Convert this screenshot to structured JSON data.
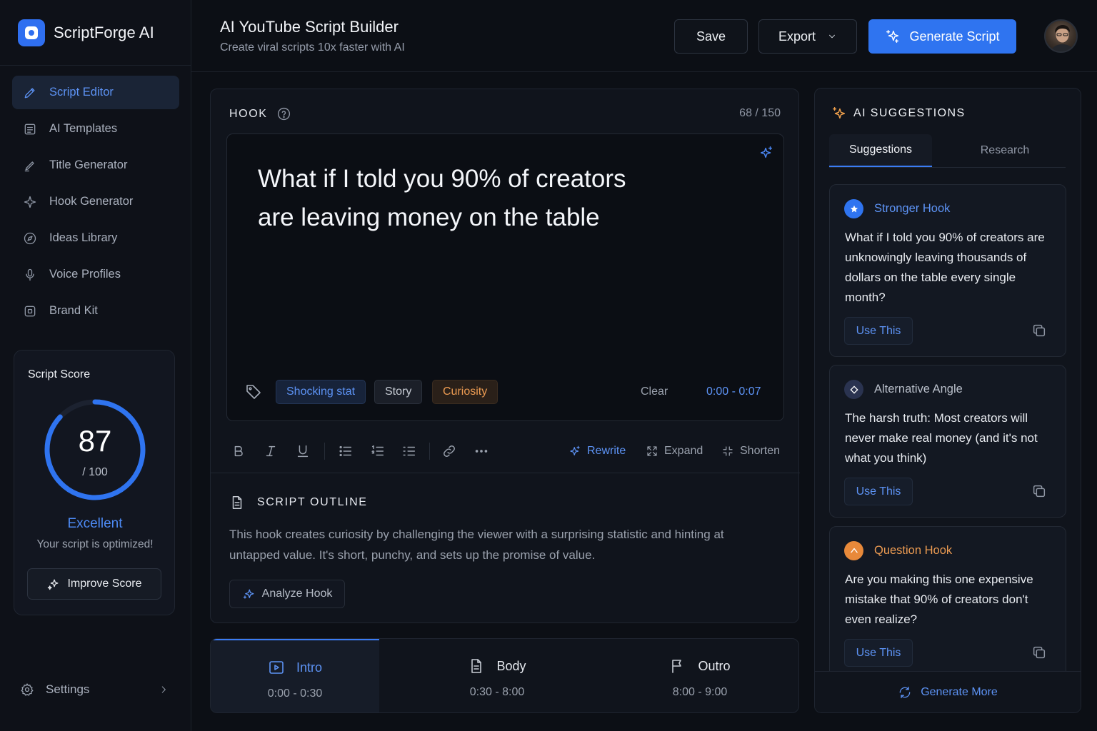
{
  "brand": {
    "name": "ScriptForge AI",
    "accent": "#2f6ff0"
  },
  "sidebar": {
    "items": [
      {
        "label": "Script Editor",
        "icon": "pencil-icon",
        "active": true
      },
      {
        "label": "AI Templates",
        "icon": "template-icon"
      },
      {
        "label": "Title Generator",
        "icon": "pen-icon"
      },
      {
        "label": "Hook Generator",
        "icon": "sparkle-icon"
      },
      {
        "label": "Ideas Library",
        "icon": "compass-icon"
      },
      {
        "label": "Voice Profiles",
        "icon": "microphone-icon"
      },
      {
        "label": "Brand Kit",
        "icon": "brand-kit-icon"
      }
    ],
    "settings_label": "Settings"
  },
  "score": {
    "title": "Script Score",
    "value": "87",
    "max": "/ 100",
    "fraction": 0.87,
    "label": "Excellent",
    "subtitle": "Your script is optimized!",
    "button": "Improve Score"
  },
  "header": {
    "title": "AI YouTube Script Builder",
    "subtitle": "Create viral scripts 10x faster with AI",
    "save": "Save",
    "export": "Export",
    "generate": "Generate Script"
  },
  "hook": {
    "label": "HOOK",
    "count": "68 / 150",
    "text": "What if I told you 90% of creators are leaving money on the table",
    "tags": [
      "Shocking stat",
      "Story",
      "Curiosity"
    ],
    "clear": "Clear",
    "time": "0:00 - 0:07"
  },
  "toolbar": {
    "rewrite": "Rewrite",
    "expand": "Expand",
    "shorten": "Shorten"
  },
  "outline": {
    "title": "SCRIPT OUTLINE",
    "text": "This hook creates curiosity by challenging the viewer with a surprising statistic and hinting at untapped value. It's short, punchy, and sets up the promise of value.",
    "analyze": "Analyze Hook"
  },
  "sections": [
    {
      "label": "Intro",
      "time": "0:00 - 0:30",
      "active": true
    },
    {
      "label": "Body",
      "time": "0:30 - 8:00"
    },
    {
      "label": "Outro",
      "time": "8:00 - 9:00"
    }
  ],
  "ai": {
    "title": "AI SUGGESTIONS",
    "tabs": [
      "Suggestions",
      "Research"
    ],
    "suggestions": [
      {
        "type": "Stronger Hook",
        "color": "#5d93f5",
        "text": "What if I told you 90% of creators are unknowingly leaving thousands of dollars on the table every single month?",
        "use": "Use This"
      },
      {
        "type": "Alternative Angle",
        "color": "#b9bfca",
        "text": "The harsh truth: Most creators will never make real money (and it's not what you think)",
        "use": "Use This"
      },
      {
        "type": "Question Hook",
        "color": "#ec9b52",
        "text": "Are you making this one expensive mistake that 90% of creators don't even realize?",
        "use": "Use This"
      }
    ],
    "generate_more": "Generate More"
  }
}
